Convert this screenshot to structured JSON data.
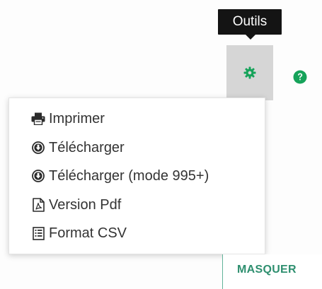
{
  "toolbar": {
    "tooltip": "Outils",
    "tools_icon": "gear-icon",
    "help_icon": "question-circle-icon",
    "accent_color": "#16a35a",
    "button_bg": "#d6d6d6"
  },
  "menu": {
    "items": [
      {
        "label": "Imprimer",
        "icon": "printer-icon"
      },
      {
        "label": "Télécharger",
        "icon": "download-circle-icon"
      },
      {
        "label": "Télécharger (mode 995+)",
        "icon": "download-circle-icon"
      },
      {
        "label": "Version Pdf",
        "icon": "pdf-file-icon"
      },
      {
        "label": "Format CSV",
        "icon": "csv-list-icon"
      }
    ]
  },
  "panel": {
    "hide_label": "MASQUER",
    "hide_color": "#2e8f6f"
  }
}
